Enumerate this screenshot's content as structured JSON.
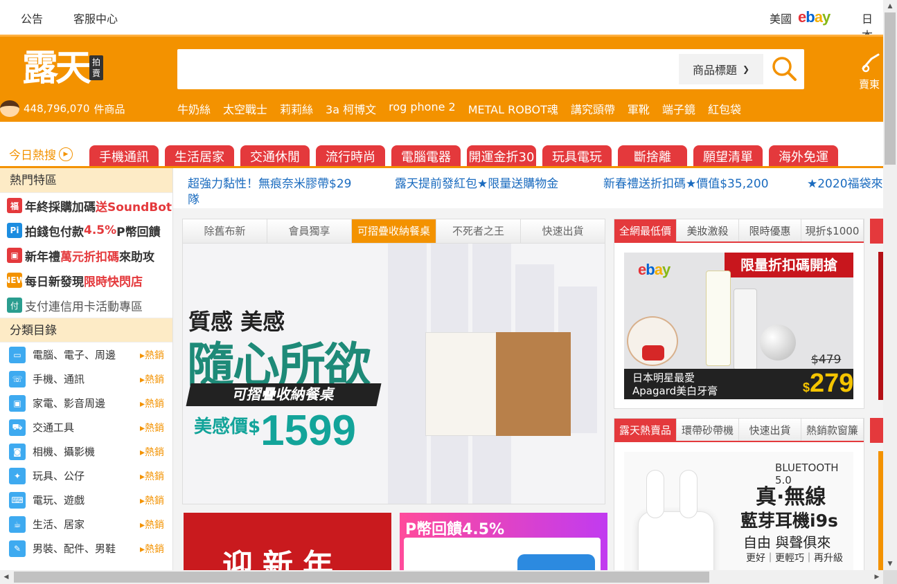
{
  "topbar": {
    "announce": "公告",
    "service": "客服中心",
    "us": "美國",
    "ebay": [
      "e",
      "b",
      "a",
      "y"
    ],
    "japan": "日本"
  },
  "header": {
    "logo": "露天",
    "logo_badge": "拍賣",
    "count_value": "448,796,070",
    "count_unit": "件商品",
    "search_placeholder": "",
    "search_select": "商品標題",
    "hot_keywords": [
      "牛奶絲",
      "太空戰士",
      "莉莉絲",
      "3a 柯博文",
      "rog phone 2",
      "METAL ROBOT魂",
      "講究頭帶",
      "軍靴",
      "端子鏡",
      "紅包袋"
    ],
    "right_cut": "賣東"
  },
  "today": {
    "label": "今日熱搜",
    "tabs": [
      "手機通訊",
      "生活居家",
      "交通休閒",
      "流行時尚",
      "電腦電器",
      "開運金折30",
      "玩具電玩",
      "斷捨離",
      "願望清單",
      "海外免運"
    ]
  },
  "sidebar": {
    "hot_zone_title": "熱門特區",
    "promos": [
      {
        "prefix": "年終採購加碼",
        "highlight": "送SoundBot",
        "suffix": "",
        "icon_char": "福",
        "color": "#e4393c"
      },
      {
        "prefix": "拍錢包付款",
        "highlight": "4.5%",
        "suffix": "P幣回饋",
        "icon_char": "Pi",
        "color": "#1c8de0"
      },
      {
        "prefix": "新年禮",
        "highlight": "萬元折扣碼",
        "suffix": "來助攻",
        "icon_char": "▣",
        "color": "#e4393c"
      },
      {
        "prefix": "每日新發現 ",
        "highlight": "限時快閃店",
        "suffix": "",
        "icon_char": "NEW",
        "color": "#f39200"
      },
      {
        "prefix": "支付連信用卡活動專區",
        "highlight": "",
        "suffix": "",
        "icon_char": "付",
        "color": "#2a9d8f"
      }
    ],
    "category_title": "分類目錄",
    "categories": [
      {
        "label": "電腦、電子、周邊",
        "hot": "▸熱銷"
      },
      {
        "label": "手機、通訊",
        "hot": "▸熱銷"
      },
      {
        "label": "家電、影音周邊",
        "hot": "▸熱銷"
      },
      {
        "label": "交通工具",
        "hot": "▸熱銷"
      },
      {
        "label": "相機、攝影機",
        "hot": "▸熱銷"
      },
      {
        "label": "玩具、公仔",
        "hot": "▸熱銷"
      },
      {
        "label": "電玩、遊戲",
        "hot": "▸熱銷"
      },
      {
        "label": "生活、居家",
        "hot": "▸熱銷"
      },
      {
        "label": "男裝、配件、男鞋",
        "hot": "▸熱銷"
      }
    ]
  },
  "marquee": {
    "items": [
      "超強力黏性！無痕奈米膠帶$29",
      "露天提前發紅包★限量送購物金",
      "新春禮送折扣碼★價值$35,200",
      "★2020福袋來"
    ],
    "wrap": "隊"
  },
  "main_banner": {
    "tabs": [
      "除舊布新",
      "會員獨享",
      "可摺疊收納餐桌",
      "不死者之王",
      "快速出貨"
    ],
    "active_tab": 2,
    "line1": "質感 美感",
    "line2": "隨心所欲",
    "strip": "可摺疊收納餐桌",
    "price_label": "美感價$",
    "price": "1599"
  },
  "bottom_banners": {
    "left_text": "迎新年",
    "right_text": "P幣回饋4.5%"
  },
  "right_box1": {
    "tabs": [
      "全網最低價",
      "美妝激殺",
      "限時優惠",
      "現折$1000"
    ],
    "ebay": [
      "e",
      "b",
      "a",
      "y"
    ],
    "ribbon": "限量折扣碼開搶",
    "line1": "日本明星最愛",
    "line2": "Apagard美白牙膏",
    "old_price": "$479",
    "price_symbol": "$",
    "price": "279"
  },
  "right_box2": {
    "tabs": [
      "露天熱賣品",
      "環帶砂帶機",
      "快速出貨",
      "熱銷款窗簾"
    ],
    "bluetooth": "BLUETOOTH 5.0",
    "line1": "真·無線",
    "line2": "藍芽耳機i9s",
    "line3": "自由 與聲俱來",
    "line4": "更好｜更輕巧｜再升級"
  },
  "colors": {
    "brand_orange": "#f39200",
    "brand_red": "#e4393c",
    "link_blue": "#1a6bbf"
  }
}
